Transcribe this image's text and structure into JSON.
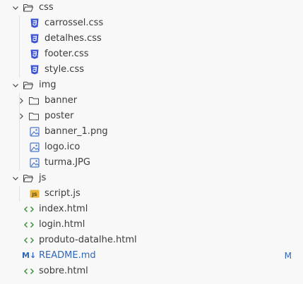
{
  "explorer": {
    "css_folder": {
      "label": "css",
      "icon": "folder-open-icon",
      "files": [
        {
          "label": "carrossel.css",
          "icon": "css-file-icon"
        },
        {
          "label": "detalhes.css",
          "icon": "css-file-icon"
        },
        {
          "label": "footer.css",
          "icon": "css-file-icon"
        },
        {
          "label": "style.css",
          "icon": "css-file-icon"
        }
      ]
    },
    "img_folder": {
      "label": "img",
      "icon": "folder-open-icon",
      "subfolders": [
        {
          "label": "banner",
          "icon": "folder-icon"
        },
        {
          "label": "poster",
          "icon": "folder-icon"
        }
      ],
      "files": [
        {
          "label": "banner_1.png",
          "icon": "image-file-icon"
        },
        {
          "label": "logo.ico",
          "icon": "image-file-icon"
        },
        {
          "label": "turma.JPG",
          "icon": "image-file-icon"
        }
      ]
    },
    "js_folder": {
      "label": "js",
      "icon": "folder-open-icon",
      "files": [
        {
          "label": "script.js",
          "icon": "js-file-icon",
          "icon_text": "JS"
        }
      ]
    },
    "root_files": [
      {
        "label": "index.html",
        "icon": "html-file-icon"
      },
      {
        "label": "login.html",
        "icon": "html-file-icon"
      },
      {
        "label": "produto-datalhe.html",
        "icon": "html-file-icon"
      },
      {
        "label": "README.md",
        "icon": "markdown-file-icon",
        "icon_text": "M↓",
        "git_status": "M"
      },
      {
        "label": "sobre.html",
        "icon": "html-file-icon"
      }
    ]
  },
  "colors": {
    "background": "#f8f8f8",
    "text": "#3b3b3b",
    "css_icon": "#3e55d1",
    "html_icon": "#3f9142",
    "image_icon": "#4a74c9",
    "js_icon": "#e8b23a",
    "modified": "#2f66b8",
    "guide": "#e0e0e0"
  }
}
